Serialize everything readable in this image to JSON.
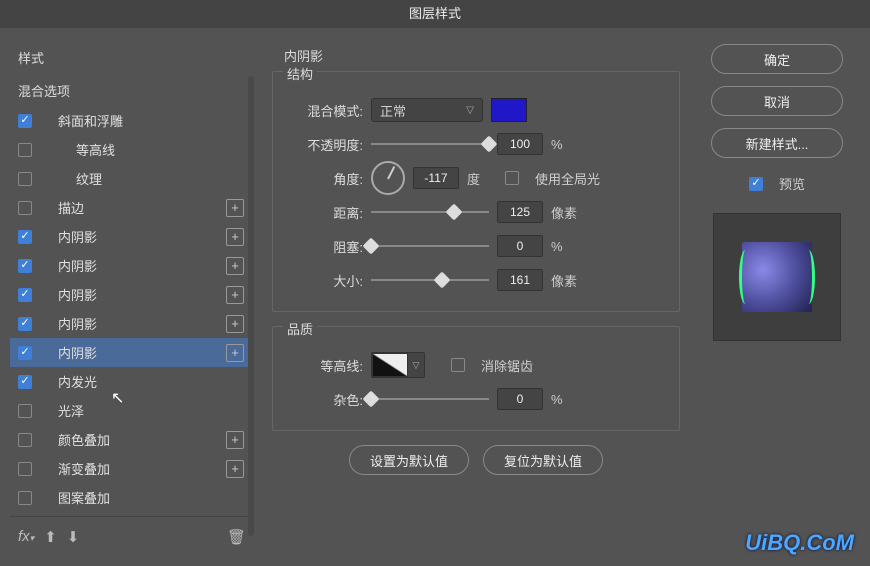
{
  "dialog": {
    "title": "图层样式"
  },
  "left": {
    "header": "样式",
    "blend_options": "混合选项",
    "items": [
      {
        "label": "斜面和浮雕",
        "checked": true,
        "indent": 1,
        "plus": false
      },
      {
        "label": "等高线",
        "checked": false,
        "indent": 2,
        "plus": false
      },
      {
        "label": "纹理",
        "checked": false,
        "indent": 2,
        "plus": false
      },
      {
        "label": "描边",
        "checked": false,
        "indent": 1,
        "plus": true
      },
      {
        "label": "内阴影",
        "checked": true,
        "indent": 1,
        "plus": true
      },
      {
        "label": "内阴影",
        "checked": true,
        "indent": 1,
        "plus": true
      },
      {
        "label": "内阴影",
        "checked": true,
        "indent": 1,
        "plus": true
      },
      {
        "label": "内阴影",
        "checked": true,
        "indent": 1,
        "plus": true
      },
      {
        "label": "内阴影",
        "checked": true,
        "indent": 1,
        "plus": true,
        "selected": true
      },
      {
        "label": "内发光",
        "checked": true,
        "indent": 1,
        "plus": false
      },
      {
        "label": "光泽",
        "checked": false,
        "indent": 1,
        "plus": false
      },
      {
        "label": "颜色叠加",
        "checked": false,
        "indent": 1,
        "plus": true
      },
      {
        "label": "渐变叠加",
        "checked": false,
        "indent": 1,
        "plus": true
      },
      {
        "label": "图案叠加",
        "checked": false,
        "indent": 1,
        "plus": false
      }
    ],
    "footer_icons": {
      "fx": "fx",
      "up": "up-arrow-icon",
      "down": "down-arrow-icon",
      "trash": "trash-icon"
    }
  },
  "middle": {
    "title": "内阴影",
    "structure_label": "结构",
    "blend_mode_label": "混合模式:",
    "blend_mode_value": "正常",
    "opacity_label": "不透明度:",
    "opacity_value": "100",
    "opacity_unit": "%",
    "angle_label": "角度:",
    "angle_value": "-117",
    "angle_unit": "度",
    "global_light_label": "使用全局光",
    "global_light_checked": false,
    "distance_label": "距离:",
    "distance_value": "125",
    "distance_unit": "像素",
    "choke_label": "阻塞:",
    "choke_value": "0",
    "choke_unit": "%",
    "size_label": "大小:",
    "size_value": "161",
    "size_unit": "像素",
    "quality_label": "品质",
    "contour_label": "等高线:",
    "antialias_label": "消除锯齿",
    "antialias_checked": false,
    "noise_label": "杂色:",
    "noise_value": "0",
    "noise_unit": "%",
    "reset_default": "设置为默认值",
    "restore_default": "复位为默认值",
    "color": "#2018c8"
  },
  "right": {
    "ok": "确定",
    "cancel": "取消",
    "new_style": "新建样式...",
    "preview_label": "预览",
    "preview_checked": true
  },
  "watermark": "UiBQ.CoM"
}
